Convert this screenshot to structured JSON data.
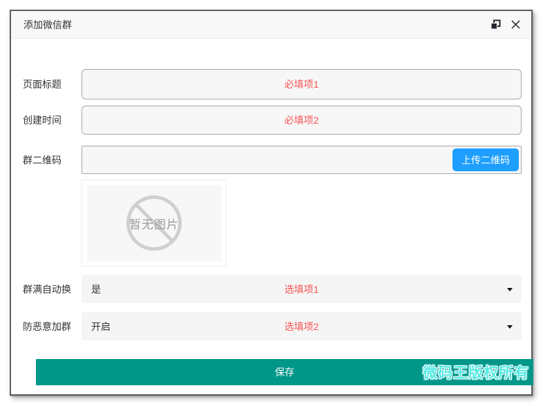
{
  "dialog": {
    "title": "添加微信群"
  },
  "form": {
    "fields": [
      {
        "label": "页面标题",
        "value": "",
        "placeholder": "必填项1"
      },
      {
        "label": "创建时间",
        "value": "",
        "placeholder": "必填项2"
      },
      {
        "label": "群二维码",
        "value": "",
        "button_label": "上传二维码"
      }
    ],
    "image_placeholder_text": "暂无图片",
    "selects": [
      {
        "label": "群满自动换",
        "value": "是",
        "hint": "选填项1"
      },
      {
        "label": "防恶意加群",
        "value": "开启",
        "hint": "选填项2"
      }
    ]
  },
  "footer": {
    "save_label": "保存",
    "watermark": "微码王版权所有"
  },
  "icons": {
    "restore": "restore-window-icon",
    "close": "close-icon",
    "dropdown": "caret-down-icon",
    "no_image": "no-image-prohibited-icon"
  },
  "colors": {
    "accent_blue": "#1E9FFF",
    "accent_green": "#009688",
    "required_red": "#f95353",
    "watermark_cyan": "#54e9e4",
    "titlebar_bg": "#f8f8f8",
    "input_bg": "#f7f7f7",
    "select_bg": "#f5f5f5"
  }
}
